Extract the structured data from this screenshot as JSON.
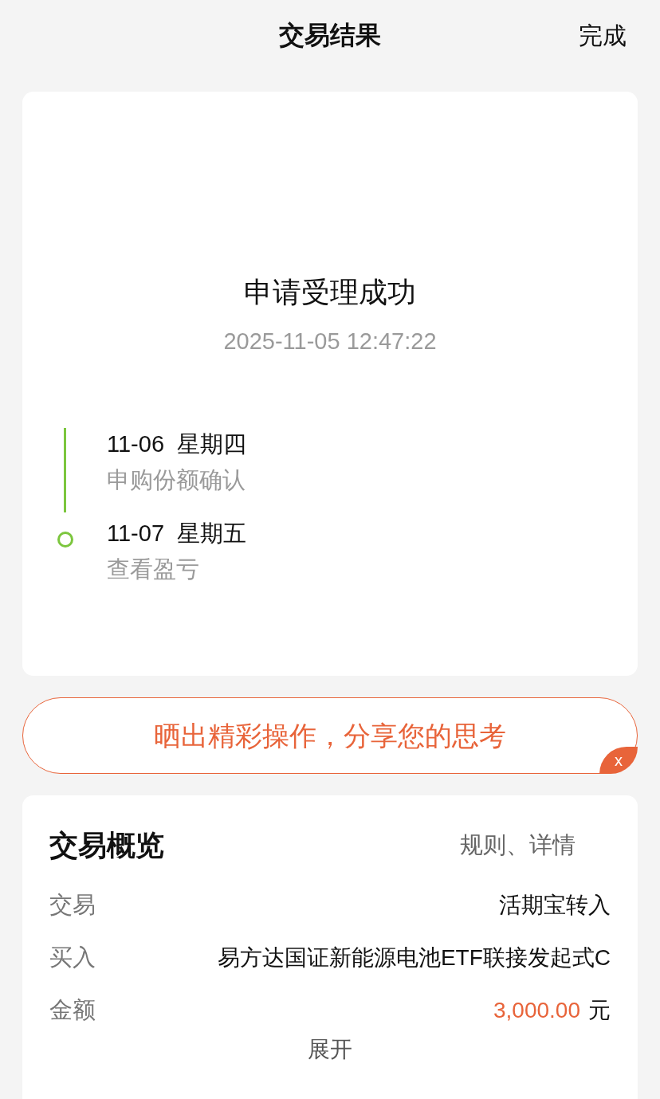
{
  "header": {
    "title": "交易结果",
    "action": "完成"
  },
  "result": {
    "title": "申请受理成功",
    "time": "2025-11-05 12:47:22",
    "steps": [
      {
        "date": "11-06  星期四",
        "desc": "申购份额确认"
      },
      {
        "date": "11-07  星期五",
        "desc": "查看盈亏"
      }
    ]
  },
  "banner": {
    "text": "晒出精彩操作，分享您的思考",
    "close": "x"
  },
  "overview": {
    "title": "交易概览",
    "link": "规则、详情",
    "rows": [
      {
        "label": "交易",
        "value": "活期宝转入",
        "highlight": false
      },
      {
        "label": "买入",
        "value": "易方达国证新能源电池ETF联接发起式C",
        "highlight": false
      },
      {
        "label": "金额",
        "value": "3,000.00",
        "unit": "元",
        "highlight": true
      }
    ],
    "expand": "展开"
  }
}
